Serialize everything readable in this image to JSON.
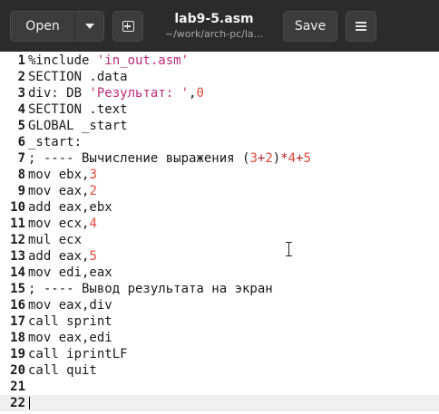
{
  "header": {
    "open_label": "Open",
    "save_label": "Save",
    "title": "lab9-5.asm",
    "subtitle": "~/work/arch-pc/la..."
  },
  "lines": [
    {
      "n": "1",
      "parts": [
        {
          "t": "%include ",
          "c": ""
        },
        {
          "t": "'in_out.asm'",
          "c": "str"
        }
      ]
    },
    {
      "n": "2",
      "parts": [
        {
          "t": "SECTION .data",
          "c": ""
        }
      ]
    },
    {
      "n": "3",
      "parts": [
        {
          "t": "div: DB ",
          "c": ""
        },
        {
          "t": "'Результат: '",
          "c": "str"
        },
        {
          "t": ",",
          "c": ""
        },
        {
          "t": "0",
          "c": "num"
        }
      ]
    },
    {
      "n": "4",
      "parts": [
        {
          "t": "SECTION .text",
          "c": ""
        }
      ]
    },
    {
      "n": "5",
      "parts": [
        {
          "t": "GLOBAL _start",
          "c": ""
        }
      ]
    },
    {
      "n": "6",
      "parts": [
        {
          "t": "_start:",
          "c": ""
        }
      ]
    },
    {
      "n": "7",
      "parts": [
        {
          "t": "; ---- Вычисление выражения (",
          "c": ""
        },
        {
          "t": "3",
          "c": "num"
        },
        {
          "t": "+",
          "c": "op"
        },
        {
          "t": "2",
          "c": "num"
        },
        {
          "t": ")",
          "c": ""
        },
        {
          "t": "*",
          "c": "op"
        },
        {
          "t": "4",
          "c": "num"
        },
        {
          "t": "+",
          "c": "op"
        },
        {
          "t": "5",
          "c": "num"
        }
      ]
    },
    {
      "n": "8",
      "parts": [
        {
          "t": "mov ebx,",
          "c": ""
        },
        {
          "t": "3",
          "c": "num"
        }
      ]
    },
    {
      "n": "9",
      "parts": [
        {
          "t": "mov eax,",
          "c": ""
        },
        {
          "t": "2",
          "c": "num"
        }
      ]
    },
    {
      "n": "10",
      "parts": [
        {
          "t": "add eax,ebx",
          "c": ""
        }
      ]
    },
    {
      "n": "11",
      "parts": [
        {
          "t": "mov ecx,",
          "c": ""
        },
        {
          "t": "4",
          "c": "num"
        }
      ]
    },
    {
      "n": "12",
      "parts": [
        {
          "t": "mul ecx",
          "c": ""
        }
      ]
    },
    {
      "n": "13",
      "parts": [
        {
          "t": "add eax,",
          "c": ""
        },
        {
          "t": "5",
          "c": "num"
        }
      ]
    },
    {
      "n": "14",
      "parts": [
        {
          "t": "mov edi,eax",
          "c": ""
        }
      ]
    },
    {
      "n": "15",
      "parts": [
        {
          "t": "; ---- Вывод результата на экран",
          "c": ""
        }
      ]
    },
    {
      "n": "16",
      "parts": [
        {
          "t": "mov eax,div",
          "c": ""
        }
      ]
    },
    {
      "n": "17",
      "parts": [
        {
          "t": "call sprint",
          "c": ""
        }
      ]
    },
    {
      "n": "18",
      "parts": [
        {
          "t": "mov eax,edi",
          "c": ""
        }
      ]
    },
    {
      "n": "19",
      "parts": [
        {
          "t": "call iprintLF",
          "c": ""
        }
      ]
    },
    {
      "n": "20",
      "parts": [
        {
          "t": "call quit",
          "c": ""
        }
      ]
    },
    {
      "n": "21",
      "parts": []
    },
    {
      "n": "22",
      "parts": []
    }
  ],
  "current_line": "22",
  "colors": {
    "headerbar": "#2b2b2b",
    "string": "#c02a79",
    "number": "#e0473b",
    "operator": "#c01c28",
    "current_line_bg": "#f0f0f0"
  }
}
